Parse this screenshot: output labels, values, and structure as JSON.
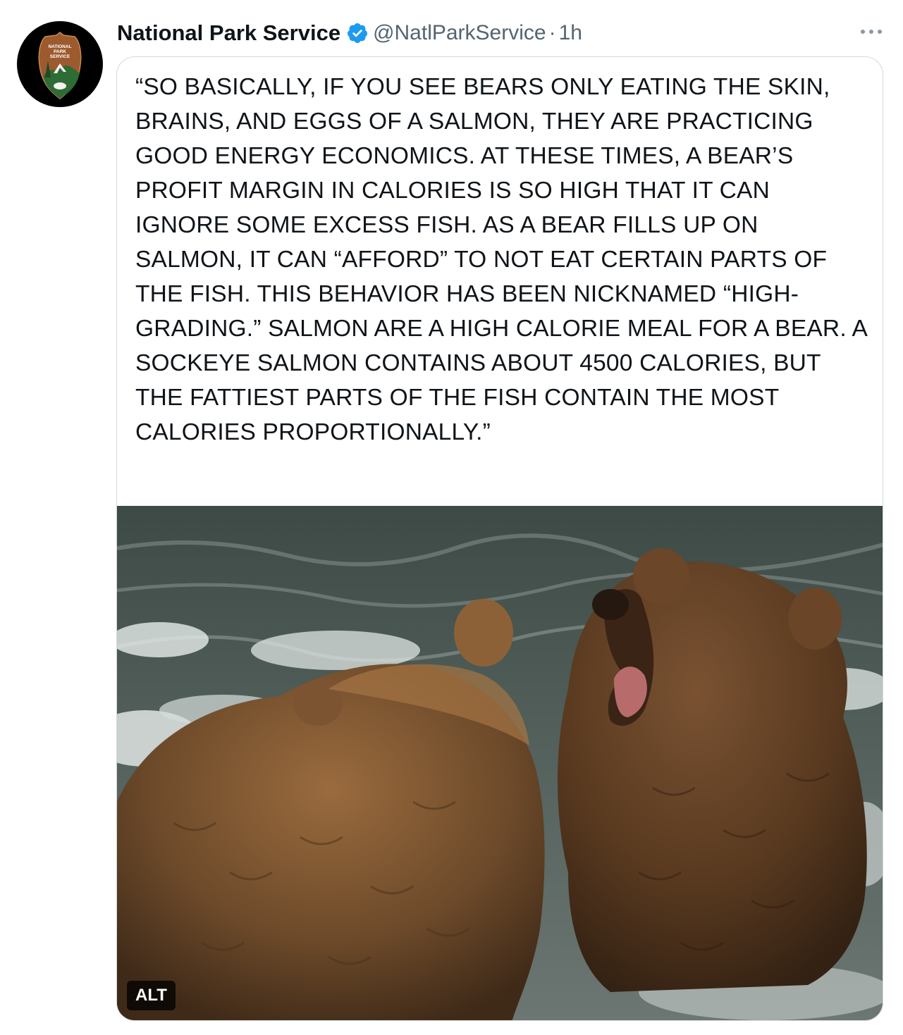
{
  "tweet": {
    "author": {
      "display_name": "National Park Service",
      "handle": "@NatlParkService",
      "verified": true,
      "avatar_icon": "nps-arrowhead-logo-icon",
      "avatar_text": [
        "NATIONAL",
        "PARK",
        "SERVICE"
      ]
    },
    "separator": "·",
    "time": "1h",
    "more_icon": "more-options-icon",
    "verified_icon": "verified-badge-icon",
    "quote_text": "“SO BASICALLY, IF YOU SEE BEARS ONLY EATING THE SKIN, BRAINS, AND EGGS OF A SALMON, THEY ARE PRACTICING GOOD ENERGY ECONOMICS. AT THESE TIMES, A BEAR’S PROFIT MARGIN IN CALORIES IS SO HIGH THAT IT CAN IGNORE SOME EXCESS FISH. AS A BEAR FILLS UP ON SALMON, IT CAN “AFFORD” TO NOT EAT CERTAIN PARTS OF THE FISH. THIS BEHAVIOR HAS BEEN NICKNAMED “HIGH-GRADING.” SALMON ARE A HIGH CALORIE MEAL FOR A BEAR. A SOCKEYE SALMON CONTAINS ABOUT 4500 CALORIES, BUT THE FATTIEST PARTS OF THE FISH CONTAIN THE MOST CALORIES PROPORTIONALLY.”",
    "media": {
      "alt_label": "ALT"
    },
    "colors": {
      "verified_blue": "#1d9bf0",
      "secondary_text": "#536471",
      "border": "#cfd9de"
    }
  }
}
